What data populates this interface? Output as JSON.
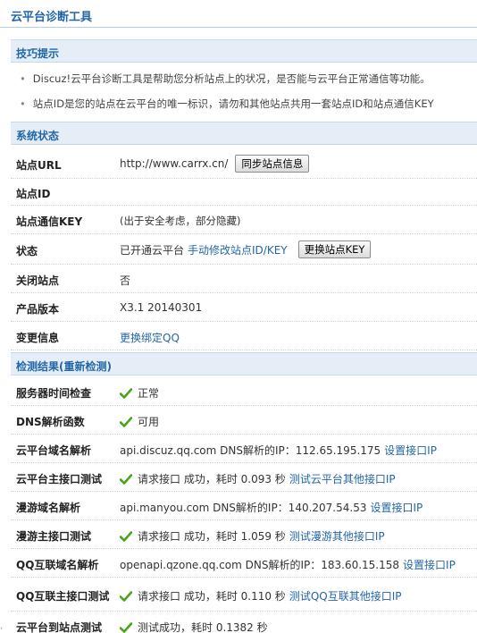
{
  "page": {
    "title": "云平台诊断工具"
  },
  "tips": {
    "header": "技巧提示",
    "items": [
      "Discuz!云平台诊断工具是帮助您分析站点上的状况，是否能与云平台正常通信等功能。",
      "站点ID是您的站点在云平台的唯一标识，请勿和其他站点共用一套站点ID和站点通信KEY"
    ]
  },
  "status": {
    "header": "系统状态",
    "site_url_label": "站点URL",
    "site_url_value": "http://www.carrx.cn/",
    "sync_button": "同步站点信息",
    "site_id_label": "站点ID",
    "site_id_value": "",
    "site_key_label": "站点通信KEY",
    "site_key_value": "(出于安全考虑，部分隐藏)",
    "state_label": "状态",
    "state_value": "已开通云平台",
    "state_link": "手动修改站点ID/KEY",
    "change_key_button": "更换站点KEY",
    "closed_label": "关闭站点",
    "closed_value": "否",
    "version_label": "产品版本",
    "version_value": "X3.1 20140301",
    "change_label": "变更信息",
    "change_link": "更换绑定QQ"
  },
  "checks": {
    "header": "检测结果(重新检测)",
    "check_icon_color": "#4aa41a",
    "rows": [
      {
        "label": "服务器时间检查",
        "text": "正常"
      },
      {
        "label": "DNS解析函数",
        "text": "可用"
      },
      {
        "label": "云平台域名解析",
        "text": "api.discuz.qq.com DNS解析的IP：112.65.195.175",
        "link": "设置接口IP"
      },
      {
        "label": "云平台主接口测试",
        "text": "请求接口 成功，耗时 0.093 秒",
        "link": "测试云平台其他接口IP"
      },
      {
        "label": "漫游域名解析",
        "text": "api.manyou.com DNS解析的IP：140.207.54.53",
        "link": "设置接口IP"
      },
      {
        "label": "漫游主接口测试",
        "text": "请求接口 成功，耗时 1.059 秒",
        "link": "测试漫游其他接口IP"
      },
      {
        "label": "QQ互联域名解析",
        "text": "openapi.qzone.qq.com DNS解析的IP：183.60.15.158",
        "link": "设置接口IP"
      },
      {
        "label": "QQ互联主接口测试",
        "text": "请求接口 成功，耗时 0.110 秒",
        "link": "测试QQ互联其他接口IP"
      },
      {
        "label": "云平台到站点测试",
        "text": "测试成功，耗时 0.1382 秒"
      }
    ]
  }
}
